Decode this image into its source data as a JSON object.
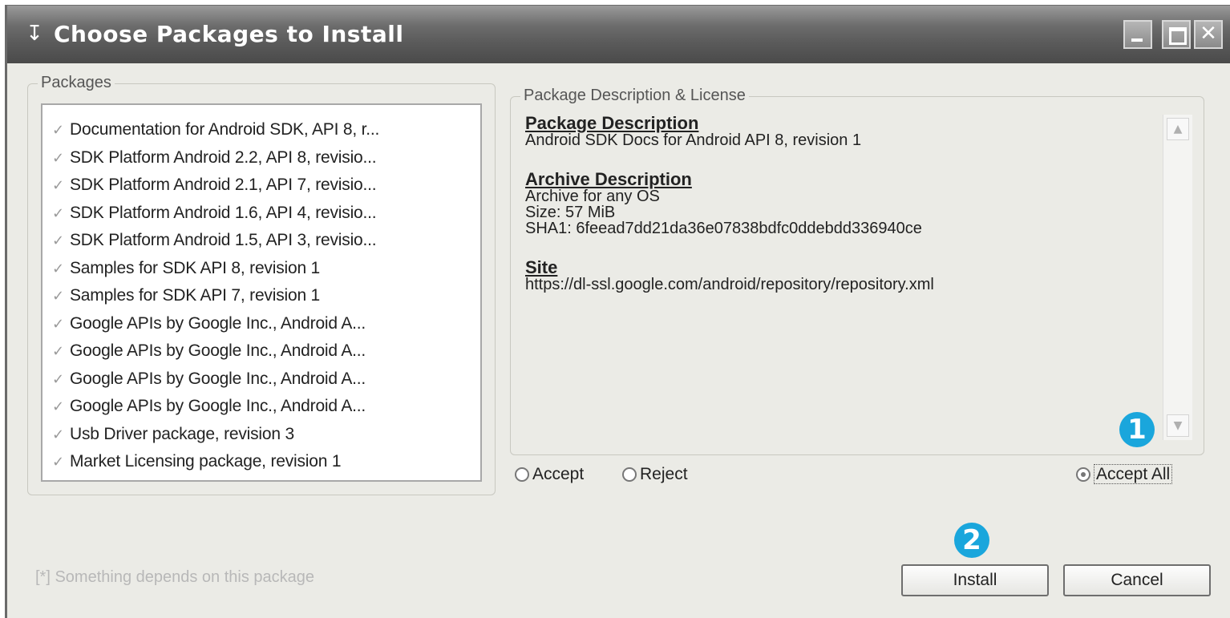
{
  "window": {
    "title": "Choose Packages to Install",
    "title_icon": "↧"
  },
  "packages": {
    "label": "Packages",
    "items": [
      {
        "label": "Documentation for Android SDK, API 8, r..."
      },
      {
        "label": "SDK Platform Android 2.2, API 8, revisio..."
      },
      {
        "label": "SDK Platform Android 2.1, API 7, revisio..."
      },
      {
        "label": "SDK Platform Android 1.6, API 4, revisio..."
      },
      {
        "label": "SDK Platform Android 1.5, API 3, revisio..."
      },
      {
        "label": "Samples for SDK API 8, revision 1"
      },
      {
        "label": "Samples for SDK API 7, revision 1"
      },
      {
        "label": "Google APIs by Google Inc., Android A..."
      },
      {
        "label": "Google APIs by Google Inc., Android A..."
      },
      {
        "label": "Google APIs by Google Inc., Android A..."
      },
      {
        "label": "Google APIs by Google Inc., Android A..."
      },
      {
        "label": "Usb Driver package, revision 3"
      },
      {
        "label": "Market Licensing package, revision 1"
      }
    ]
  },
  "description": {
    "group_label": "Package Description & License",
    "package_description_heading": "Package Description",
    "package_description_text": "Android SDK Docs for Android API 8, revision 1",
    "archive_description_heading": "Archive Description",
    "archive_os": "Archive for any OS",
    "archive_size": "Size: 57 MiB",
    "archive_sha1": "SHA1: 6feead7dd21da36e07838bdfc0ddebdd336940ce",
    "site_heading": "Site",
    "site_url": "https://dl-ssl.google.com/android/repository/repository.xml"
  },
  "license": {
    "accept_label": "Accept",
    "reject_label": "Reject",
    "accept_all_label": "Accept All",
    "selected": "accept_all"
  },
  "callouts": {
    "one": "1",
    "two": "2"
  },
  "footer": {
    "note": "[*] Something depends on this package",
    "install_label": "Install",
    "cancel_label": "Cancel"
  }
}
